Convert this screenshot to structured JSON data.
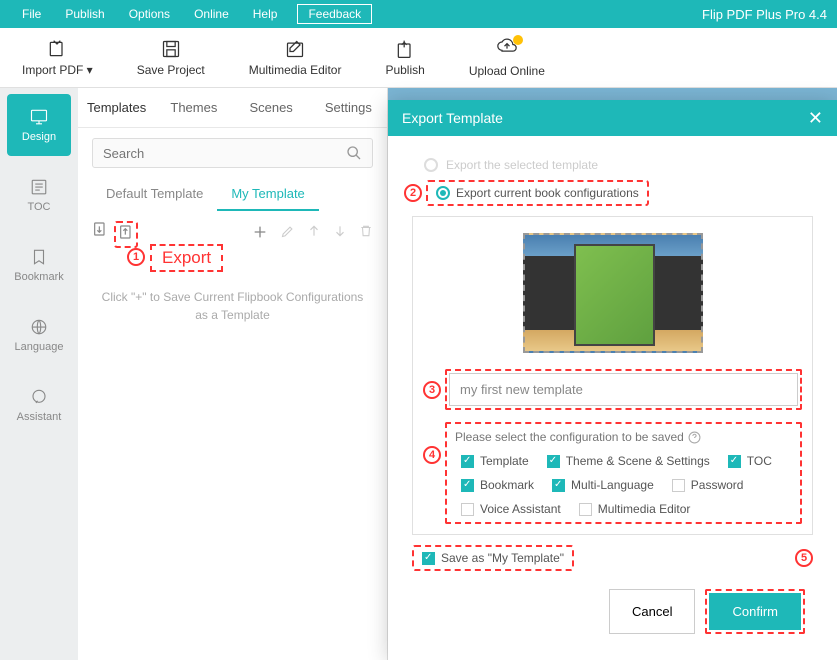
{
  "app": {
    "title": "Flip PDF Plus Pro 4.4"
  },
  "menu": {
    "file": "File",
    "publish": "Publish",
    "options": "Options",
    "online": "Online",
    "help": "Help",
    "feedback": "Feedback"
  },
  "toolbar": {
    "import": "Import PDF ▾",
    "save": "Save Project",
    "multimedia": "Multimedia Editor",
    "publish": "Publish",
    "upload": "Upload Online"
  },
  "vtabs": {
    "design": "Design",
    "toc": "TOC",
    "bookmark": "Bookmark",
    "language": "Language",
    "assistant": "Assistant"
  },
  "panel": {
    "tabs": {
      "templates": "Templates",
      "themes": "Themes",
      "scenes": "Scenes",
      "settings": "Settings"
    },
    "search_placeholder": "Search",
    "subtabs": {
      "default": "Default Template",
      "my": "My Template"
    },
    "hint": "Click \"+\" to Save Current Flipbook Configurations as a Template"
  },
  "callouts": {
    "c1": "1",
    "c1_label": "Export",
    "c2": "2",
    "c3": "3",
    "c4": "4",
    "c5": "5"
  },
  "modal": {
    "title": "Export Template",
    "radio_selected": "Export the selected template",
    "radio_current": "Export current book configurations",
    "name_value": "my first new template",
    "config_label": "Please select the configuration to be saved",
    "checks": {
      "template": "Template",
      "theme": "Theme & Scene & Settings",
      "toc": "TOC",
      "bookmark": "Bookmark",
      "multilang": "Multi-Language",
      "password": "Password",
      "voice": "Voice Assistant",
      "mmeditor": "Multimedia Editor"
    },
    "save_as": "Save as \"My Template\"",
    "cancel": "Cancel",
    "confirm": "Confirm"
  }
}
